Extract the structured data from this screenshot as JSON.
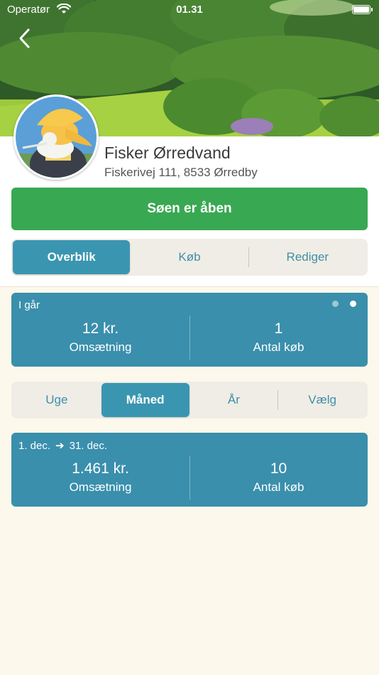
{
  "status_bar": {
    "carrier": "Operatør",
    "time": "01.31",
    "icons": [
      "wifi-icon",
      "battery-icon"
    ]
  },
  "nav": {
    "back_icon": "chevron-left-icon"
  },
  "venue": {
    "name": "Fisker Ørredvand",
    "address": "Fiskerivej 111, 8533 Ørredby",
    "avatar": "fisherman-avatar"
  },
  "status_button": {
    "label": "Søen er åben",
    "color": "#39a852"
  },
  "tabs": [
    {
      "label": "Overblik",
      "active": true
    },
    {
      "label": "Køb",
      "active": false
    },
    {
      "label": "Rediger",
      "active": false
    }
  ],
  "yesterday_card": {
    "title": "I går",
    "revenue_value": "12 kr.",
    "revenue_label": "Omsætning",
    "purchases_value": "1",
    "purchases_label": "Antal køb",
    "pages": 2,
    "active_page": 2
  },
  "periods": [
    {
      "label": "Uge",
      "active": false
    },
    {
      "label": "Måned",
      "active": true
    },
    {
      "label": "År",
      "active": false
    },
    {
      "label": "Vælg",
      "active": false
    }
  ],
  "range_card": {
    "start": "1. dec.",
    "arrow": "➔",
    "end": "31. dec.",
    "revenue_value": "1.461 kr.",
    "revenue_label": "Omsætning",
    "purchases_value": "10",
    "purchases_label": "Antal køb"
  },
  "colors": {
    "accent": "#3a96b0",
    "card": "#3a8fac",
    "background": "#fdf8ec",
    "open_green": "#39a852"
  }
}
